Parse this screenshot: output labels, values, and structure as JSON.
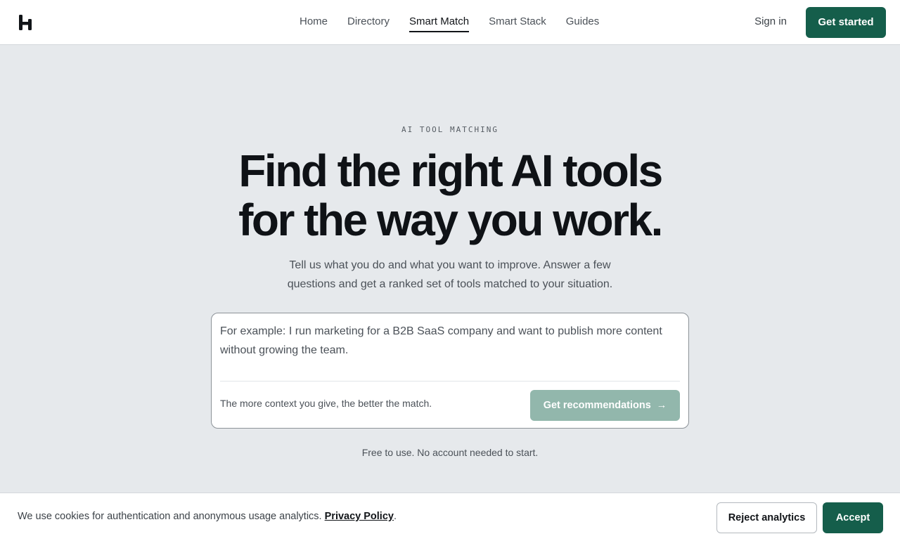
{
  "header": {
    "logo_icon": "h-logo-icon",
    "nav": [
      {
        "label": "Home"
      },
      {
        "label": "Directory"
      },
      {
        "label": "Smart Match",
        "active": true
      },
      {
        "label": "Smart Stack"
      },
      {
        "label": "Guides"
      }
    ],
    "signin_label": "Sign in",
    "get_started_label": "Get started"
  },
  "hero": {
    "eyebrow": "AI TOOL MATCHING",
    "headline_line1": "Find the right AI tools",
    "headline_line2": "for the way you work.",
    "subtitle": "Tell us what you do and what you want to improve. Answer a few questions and get a ranked set of tools matched to your situation."
  },
  "match_form": {
    "placeholder": "For example: I run marketing for a B2B SaaS company and want to publish more content without growing the team.",
    "hint": "The more context you give, the better the match.",
    "submit_label": "Get recommendations",
    "submit_icon": "arrow-right-icon"
  },
  "free_note": "Free to use. No account needed to start.",
  "cookie_banner": {
    "text": "We use cookies for authentication and anonymous usage analytics.",
    "policy_link": "Privacy Policy",
    "policy_suffix": ".",
    "reject_label": "Reject analytics",
    "accept_label": "Accept"
  },
  "colors": {
    "brand": "#155e4b",
    "brand_disabled": "#92b7ac",
    "page_bg": "#e6e9ec"
  }
}
